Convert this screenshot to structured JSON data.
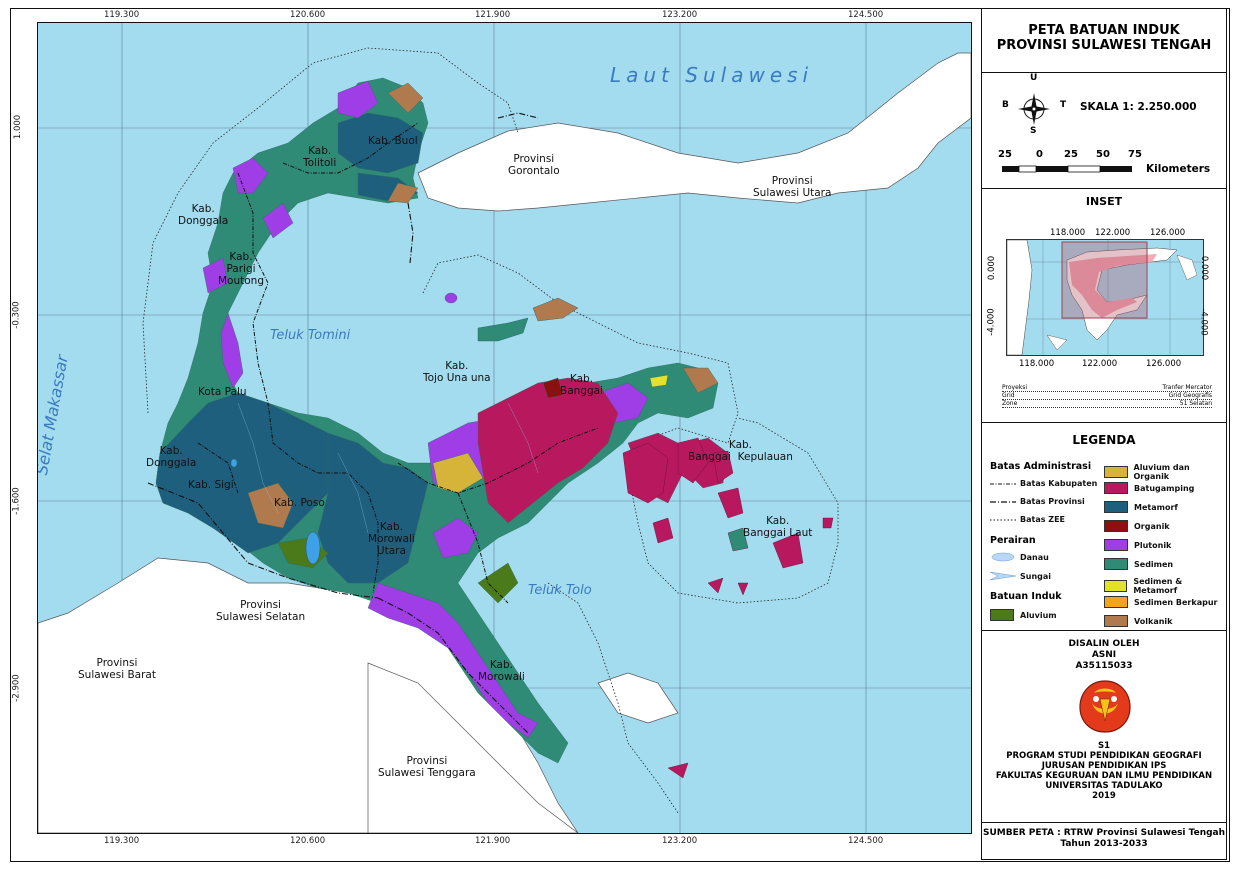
{
  "title": {
    "line1": "PETA BATUAN INDUK",
    "line2": "PROVINSI SULAWESI TENGAH"
  },
  "compass": {
    "n": "U",
    "s": "S",
    "w": "B",
    "e": "T"
  },
  "scale": {
    "text": "SKALA  1: 2.250.000",
    "ticks": [
      "25",
      "0",
      "25",
      "50",
      "75"
    ],
    "unit": "Kilometers"
  },
  "inset": {
    "heading": "INSET",
    "top_ticks": [
      "118.000",
      "122.000",
      "126.000"
    ],
    "bottom_ticks": [
      "118.000",
      "122.000",
      "126.000"
    ],
    "left_ticks": [
      "0.000",
      "-4.000"
    ],
    "right_ticks": [
      "0.000",
      "-4.000"
    ]
  },
  "projection": {
    "rows": [
      {
        "key": "Proyeksi",
        "value": "Tranfer Mercator"
      },
      {
        "key": "Grid",
        "value": "Grid Geografis"
      },
      {
        "key": "Zone",
        "value": "51 Selatan"
      }
    ]
  },
  "legend": {
    "heading": "LEGENDA",
    "admin_heading": "Batas Administrasi",
    "admin_items": [
      "Batas Kabupaten",
      "Batas Provinsi",
      "Batas ZEE"
    ],
    "water_heading": "Perairan",
    "water_items": [
      "Danau",
      "Sungai"
    ],
    "rock_heading": "Batuan Induk",
    "rock_left": [
      {
        "label": "Aluvium",
        "color": "#4a7a1a"
      }
    ],
    "rock_right": [
      {
        "label": "Aluvium dan Organik",
        "color": "#d6b43a"
      },
      {
        "label": "Batugamping",
        "color": "#b8195e"
      },
      {
        "label": "Metamorf",
        "color": "#1f5f7e"
      },
      {
        "label": "Organik",
        "color": "#8b1010"
      },
      {
        "label": "Plutonik",
        "color": "#9f3ee6"
      },
      {
        "label": "Sedimen",
        "color": "#2f8a76"
      },
      {
        "label": "Sedimen & Metamorf",
        "color": "#e2e22a"
      },
      {
        "label": "Sedimen Berkapur",
        "color": "#f5a21f"
      },
      {
        "label": "Volkanik",
        "color": "#b07a4e"
      }
    ]
  },
  "credit": {
    "lines": [
      "DISALIN OLEH",
      "ASNI",
      "A35115033"
    ],
    "lines2": [
      "S1",
      "PROGRAM STUDI PENDIDIKAN GEOGRAFI",
      "JURUSAN PENDIDIKAN IPS",
      "FAKULTAS KEGURUAN DAN ILMU PENDIDIKAN",
      "UNIVERSITAS TADULAKO",
      "2019"
    ]
  },
  "source": {
    "line1": "SUMBER PETA : RTRW Provinsi Sulawesi Tengah",
    "line2": "Tahun 2013-2033"
  },
  "map": {
    "lon_ticks": [
      "119.300",
      "120.600",
      "121.900",
      "123.200",
      "124.500"
    ],
    "lat_ticks": [
      "1.000",
      "-0.300",
      "-1.600",
      "-2.900"
    ],
    "seas": {
      "laut_sulawesi": "Laut Sulawesi",
      "selat_makassar": "Selat Makassar",
      "teluk_tomini": "Teluk Tomini",
      "teluk_tolo": "Teluk Tolo"
    },
    "labels": {
      "buol": "Kab. Buol",
      "tolitoli": "Kab.\nTolitoli",
      "donggala_n": "Kab.\nDonggala",
      "parigi": "Kab.\nParigi\nMoutong",
      "kota_palu": "Kota Palu",
      "donggala_s": "Kab.\nDonggala",
      "sigi": "Kab. Sigi",
      "poso": "Kab. Poso",
      "tojo": "Kab.\nTojo Una una",
      "banggai": "Kab.\nBanggai",
      "bangkep": "Kab.\nBanggai  Kepulauan",
      "banglaut": "Kab.\nBanggai Laut",
      "morowali_utara": "Kab.\nMorowali\nUtara",
      "morowali": "Kab.\nMorowali",
      "gorontalo": "Provinsi\nGorontalo",
      "sulut": "Provinsi\nSulawesi Utara",
      "sulsel": "Provinsi\nSulawesi Selatan",
      "sulbar": "Provinsi\nSulawesi Barat",
      "sultra": "Provinsi\nSulawesi Tenggara"
    }
  }
}
